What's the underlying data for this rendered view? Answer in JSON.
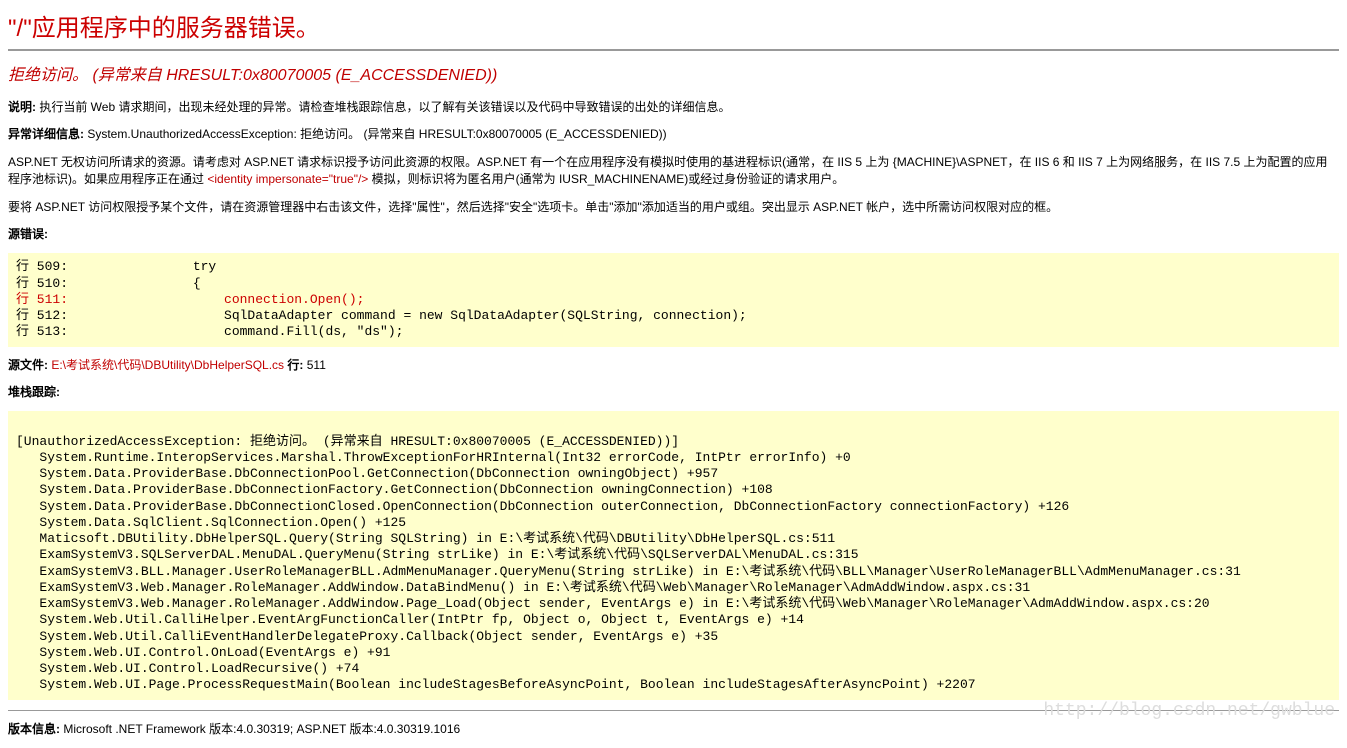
{
  "header": {
    "title": "\"/\"应用程序中的服务器错误。"
  },
  "subheader": {
    "title": "拒绝访问。 (异常来自 HRESULT:0x80070005 (E_ACCESSDENIED))"
  },
  "description": {
    "label": "说明: ",
    "text": "执行当前 Web 请求期间，出现未经处理的异常。请检查堆栈跟踪信息，以了解有关该错误以及代码中导致错误的出处的详细信息。"
  },
  "exception": {
    "label": "异常详细信息: ",
    "text": "System.UnauthorizedAccessException: 拒绝访问。 (异常来自 HRESULT:0x80070005 (E_ACCESSDENIED))"
  },
  "aspnet_note": {
    "pre": "ASP.NET 无权访问所请求的资源。请考虑对 ASP.NET 请求标识授予访问此资源的权限。ASP.NET 有一个在应用程序没有模拟时使用的基进程标识(通常，在 IIS 5 上为 {MACHINE}\\ASPNET，在 IIS 6 和 IIS 7 上为网络服务，在 IIS 7.5 上为配置的应用程序池标识)。如果应用程序正在通过 ",
    "identity_tag": "<identity impersonate=\"true\"/>",
    "post": " 模拟，则标识将为匿名用户(通常为 IUSR_MACHINENAME)或经过身份验证的请求用户。"
  },
  "aspnet_grant": {
    "text": "要将 ASP.NET 访问权限授予某个文件，请在资源管理器中右击该文件，选择\"属性\"，然后选择\"安全\"选项卡。单击\"添加\"添加适当的用户或组。突出显示 ASP.NET 帐户，选中所需访问权限对应的框。"
  },
  "source_error": {
    "label": "源错误:",
    "line_a": "行 509:                try",
    "line_b": "行 510:                {",
    "line_c": "行 511:                    connection.Open();",
    "line_d": "行 512:                    SqlDataAdapter command = new SqlDataAdapter(SQLString, connection);",
    "line_e": "行 513:                    command.Fill(ds, \"ds\");"
  },
  "source_file": {
    "label": "源文件: ",
    "path": "E:\\考试系统\\代码\\DBUtility\\DbHelperSQL.cs",
    "line_label": "    行: ",
    "line_no": "511"
  },
  "stack": {
    "label": "堆栈跟踪:",
    "text": "\n[UnauthorizedAccessException: 拒绝访问。 (异常来自 HRESULT:0x80070005 (E_ACCESSDENIED))]\n   System.Runtime.InteropServices.Marshal.ThrowExceptionForHRInternal(Int32 errorCode, IntPtr errorInfo) +0\n   System.Data.ProviderBase.DbConnectionPool.GetConnection(DbConnection owningObject) +957\n   System.Data.ProviderBase.DbConnectionFactory.GetConnection(DbConnection owningConnection) +108\n   System.Data.ProviderBase.DbConnectionClosed.OpenConnection(DbConnection outerConnection, DbConnectionFactory connectionFactory) +126\n   System.Data.SqlClient.SqlConnection.Open() +125\n   Maticsoft.DBUtility.DbHelperSQL.Query(String SQLString) in E:\\考试系统\\代码\\DBUtility\\DbHelperSQL.cs:511\n   ExamSystemV3.SQLServerDAL.MenuDAL.QueryMenu(String strLike) in E:\\考试系统\\代码\\SQLServerDAL\\MenuDAL.cs:315\n   ExamSystemV3.BLL.Manager.UserRoleManagerBLL.AdmMenuManager.QueryMenu(String strLike) in E:\\考试系统\\代码\\BLL\\Manager\\UserRoleManagerBLL\\AdmMenuManager.cs:31\n   ExamSystemV3.Web.Manager.RoleManager.AddWindow.DataBindMenu() in E:\\考试系统\\代码\\Web\\Manager\\RoleManager\\AdmAddWindow.aspx.cs:31\n   ExamSystemV3.Web.Manager.RoleManager.AddWindow.Page_Load(Object sender, EventArgs e) in E:\\考试系统\\代码\\Web\\Manager\\RoleManager\\AdmAddWindow.aspx.cs:20\n   System.Web.Util.CalliHelper.EventArgFunctionCaller(IntPtr fp, Object o, Object t, EventArgs e) +14\n   System.Web.Util.CalliEventHandlerDelegateProxy.Callback(Object sender, EventArgs e) +35\n   System.Web.UI.Control.OnLoad(EventArgs e) +91\n   System.Web.UI.Control.LoadRecursive() +74\n   System.Web.UI.Page.ProcessRequestMain(Boolean includeStagesBeforeAsyncPoint, Boolean includeStagesAfterAsyncPoint) +2207\n"
  },
  "version": {
    "label": "版本信息: ",
    "text": "Microsoft .NET Framework 版本:4.0.30319; ASP.NET 版本:4.0.30319.1016"
  },
  "watermark": "http://blog.csdn.net/gwblue"
}
